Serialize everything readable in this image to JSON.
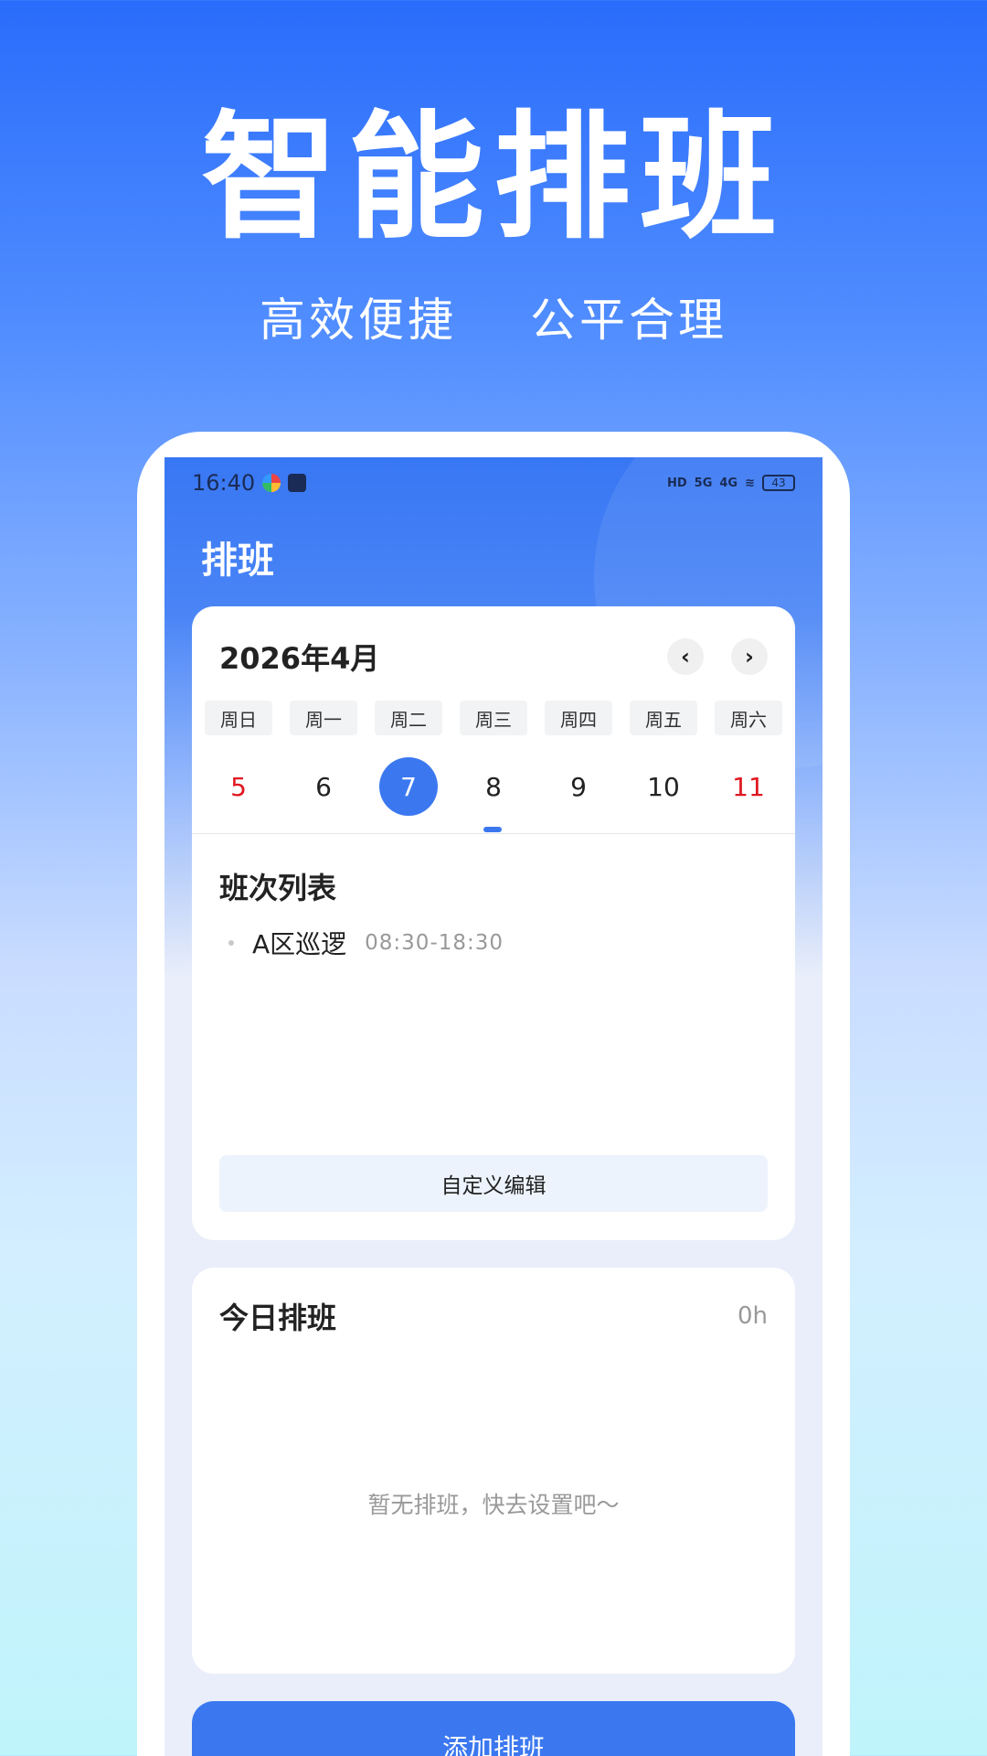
{
  "hero": {
    "title": "智能排班",
    "subtitle_left": "高效便捷",
    "subtitle_right": "公平合理"
  },
  "status_bar": {
    "time": "16:40",
    "network_1": "5G",
    "network_2": "4G",
    "hd": "HD",
    "battery": "43"
  },
  "app": {
    "title": "排班"
  },
  "calendar": {
    "month_label": "2026年4月",
    "prev_icon": "‹",
    "next_icon": "›",
    "weekdays": [
      "周日",
      "周一",
      "周二",
      "周三",
      "周四",
      "周五",
      "周六"
    ],
    "days": [
      "5",
      "6",
      "7",
      "8",
      "9",
      "10",
      "11"
    ],
    "selected_day": "7"
  },
  "shift_list": {
    "title": "班次列表",
    "items": [
      {
        "name": "A区巡逻",
        "time": "08:30-18:30"
      }
    ],
    "edit_button": "自定义编辑"
  },
  "today": {
    "title": "今日排班",
    "hours": "0h",
    "empty_text": "暂无排班，快去设置吧～"
  },
  "add_button": "添加排班",
  "colors": {
    "accent": "#3b78f0",
    "weekend": "#e0171f"
  }
}
